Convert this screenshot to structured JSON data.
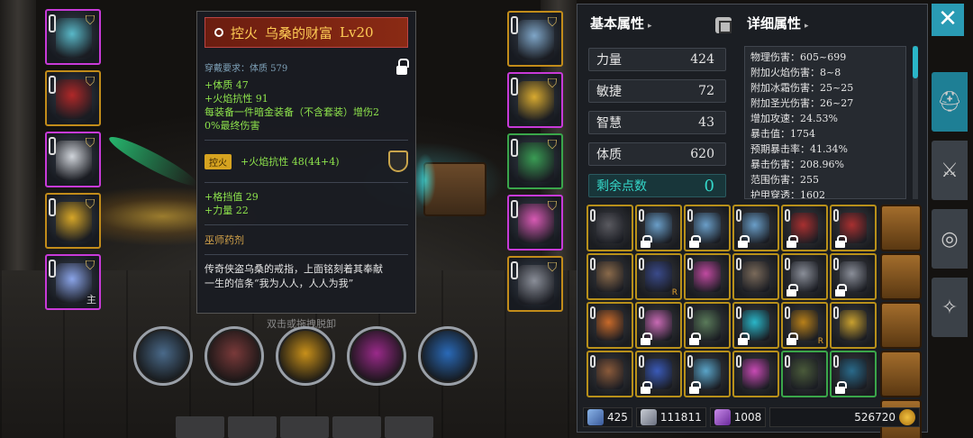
{
  "tooltip": {
    "set_name": "控火",
    "item_name": "乌桑的财富",
    "level": "Lv20",
    "requirement": "穿戴要求：体质 579",
    "stats_primary": [
      "+体质 47",
      "+火焰抗性 91",
      "每装备一件暗金装备（不含套装）增伤2",
      "0%最终伤害"
    ],
    "set_tag": "控火",
    "set_stat": "+火焰抗性 48(44+4)",
    "stats_secondary": [
      "+格挡值 29",
      "+力量 22"
    ],
    "subtitle": "巫师药剂",
    "description": [
      "传奇侠盗乌桑的戒指，上面铭刻着其奉献",
      "一生的信条“我为人人，人人为我”"
    ]
  },
  "hint": "双击或拖拽脱卸",
  "left_equipment": [
    {
      "name": "helmet",
      "color": "#59b8c8",
      "border": "purple"
    },
    {
      "name": "armor",
      "color": "#b02828",
      "border": "gold"
    },
    {
      "name": "shoulders",
      "color": "#d0d4da",
      "border": "purple"
    },
    {
      "name": "ring-gold",
      "color": "#d6a628",
      "border": "gold"
    },
    {
      "name": "weapon",
      "color": "#8aa4e8",
      "border": "purple",
      "main_mark": "主"
    }
  ],
  "right_equipment": [
    {
      "name": "amulet",
      "color": "#7fa6c8",
      "border": "gold"
    },
    {
      "name": "belt-tassel",
      "color": "#d8aa30",
      "border": "purple"
    },
    {
      "name": "boots",
      "color": "#3a9c54",
      "border": "green"
    },
    {
      "name": "ring-pink",
      "color": "#d85ab4",
      "border": "purple"
    },
    {
      "name": "offhand-shield",
      "color": "#8a8e98",
      "border": "gold"
    }
  ],
  "panel": {
    "basic_header": "基本属性",
    "detail_header": "详细属性",
    "basic": [
      {
        "label": "力量",
        "value": "424"
      },
      {
        "label": "敏捷",
        "value": "72"
      },
      {
        "label": "智慧",
        "value": "43"
      },
      {
        "label": "体质",
        "value": "620"
      }
    ],
    "remaining": {
      "label": "剩余点数",
      "value": "0"
    },
    "detail_lines": [
      "物理伤害：605~699",
      "附加火焰伤害：8~8",
      "附加冰霜伤害：25~25",
      "附加圣光伤害：26~27",
      "增加攻速：24.53%",
      "暴击值：1754",
      "预期暴击率：41.34%",
      "暴击伤害：208.96%",
      "范围伤害：255",
      "护甲穿透：1602"
    ]
  },
  "inventory": [
    {
      "color": "#5a5a60",
      "lock": false,
      "border": "gold"
    },
    {
      "color": "#6a9ec8",
      "lock": true,
      "border": "gold"
    },
    {
      "color": "#6a9ec8",
      "lock": true,
      "border": "gold"
    },
    {
      "color": "#6a9ec8",
      "lock": true,
      "border": "gold"
    },
    {
      "color": "#a83030",
      "lock": true,
      "border": "gold"
    },
    {
      "color": "#a83030",
      "lock": true,
      "border": "gold"
    },
    {
      "color": "#8a6a4a",
      "lock": false,
      "border": "gold"
    },
    {
      "color": "#3a4a8a",
      "lock": false,
      "border": "gold",
      "badge": "R"
    },
    {
      "color": "#c04aa0",
      "lock": false,
      "border": "gold"
    },
    {
      "color": "#7a6a5a",
      "lock": false,
      "border": "gold"
    },
    {
      "color": "#8a8e98",
      "lock": true,
      "border": "gold"
    },
    {
      "color": "#8a8e98",
      "lock": true,
      "border": "gold"
    },
    {
      "color": "#c86a2a",
      "lock": false,
      "border": "gold"
    },
    {
      "color": "#c86ab4",
      "lock": true,
      "border": "gold"
    },
    {
      "color": "#5a7a5a",
      "lock": true,
      "border": "gold"
    },
    {
      "color": "#2ab6c8",
      "lock": true,
      "border": "gold"
    },
    {
      "color": "#b8801a",
      "lock": true,
      "border": "gold",
      "badge": "R"
    },
    {
      "color": "#c8a030",
      "lock": false,
      "border": "gold"
    },
    {
      "color": "#8a5a3a",
      "lock": false,
      "border": "gold"
    },
    {
      "color": "#3a5ab8",
      "lock": true,
      "border": "gold"
    },
    {
      "color": "#5aa4c8",
      "lock": true,
      "border": "gold"
    },
    {
      "color": "#c84ab4",
      "lock": false,
      "border": "gold"
    },
    {
      "color": "#4a5a3a",
      "lock": false,
      "border": "green"
    },
    {
      "color": "#2a6a8a",
      "lock": true,
      "border": "green"
    }
  ],
  "bag_count": 5,
  "skills": [
    {
      "name": "sword-skill",
      "color": "#4a6a8a"
    },
    {
      "name": "axe-skill",
      "color": "#7a3a3a"
    },
    {
      "name": "shield-skill",
      "color": "#c8901a"
    },
    {
      "name": "slash-skill",
      "color": "#9a2a8a"
    },
    {
      "name": "frost-skill",
      "color": "#2a6ab8"
    }
  ],
  "currency": {
    "attack": "425",
    "defense": "111811",
    "crystal": "1008",
    "gold": "526720"
  },
  "colors": {
    "accent": "#2a9bb4",
    "gold_border": "#b8901a",
    "purple_border": "#c83ad8",
    "green_border": "#3aa64a",
    "stat_green": "#8ee44c"
  }
}
